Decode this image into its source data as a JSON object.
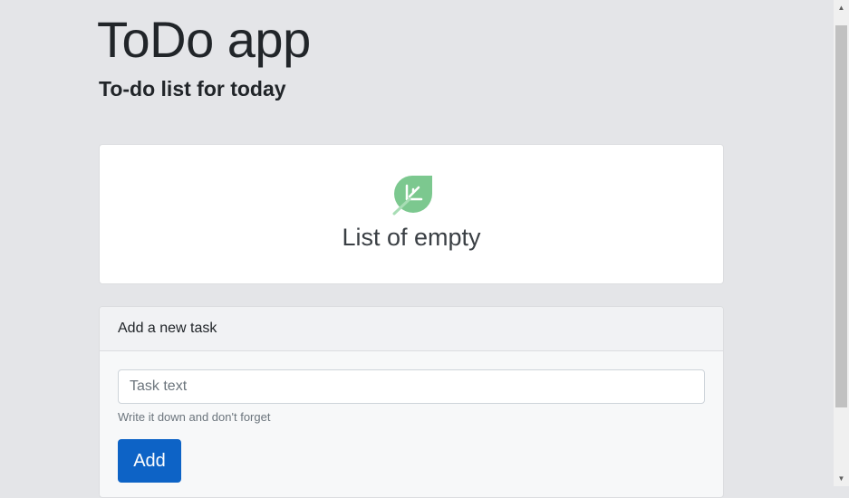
{
  "header": {
    "title": "ToDo app",
    "subtitle": "To-do list for today"
  },
  "empty_state": {
    "icon": "leaf-icon",
    "message": "List of empty"
  },
  "new_task": {
    "header": "Add a new task",
    "input_value": "",
    "input_placeholder": "Task text",
    "help_text": "Write it down and don't forget",
    "add_label": "Add"
  },
  "colors": {
    "background": "#e4e5e8",
    "primary_button": "#0d63c6",
    "leaf_green": "#7cc88f"
  },
  "scrollbar": {
    "up_icon": "scroll-up-arrow-icon",
    "down_icon": "scroll-down-arrow-icon"
  }
}
